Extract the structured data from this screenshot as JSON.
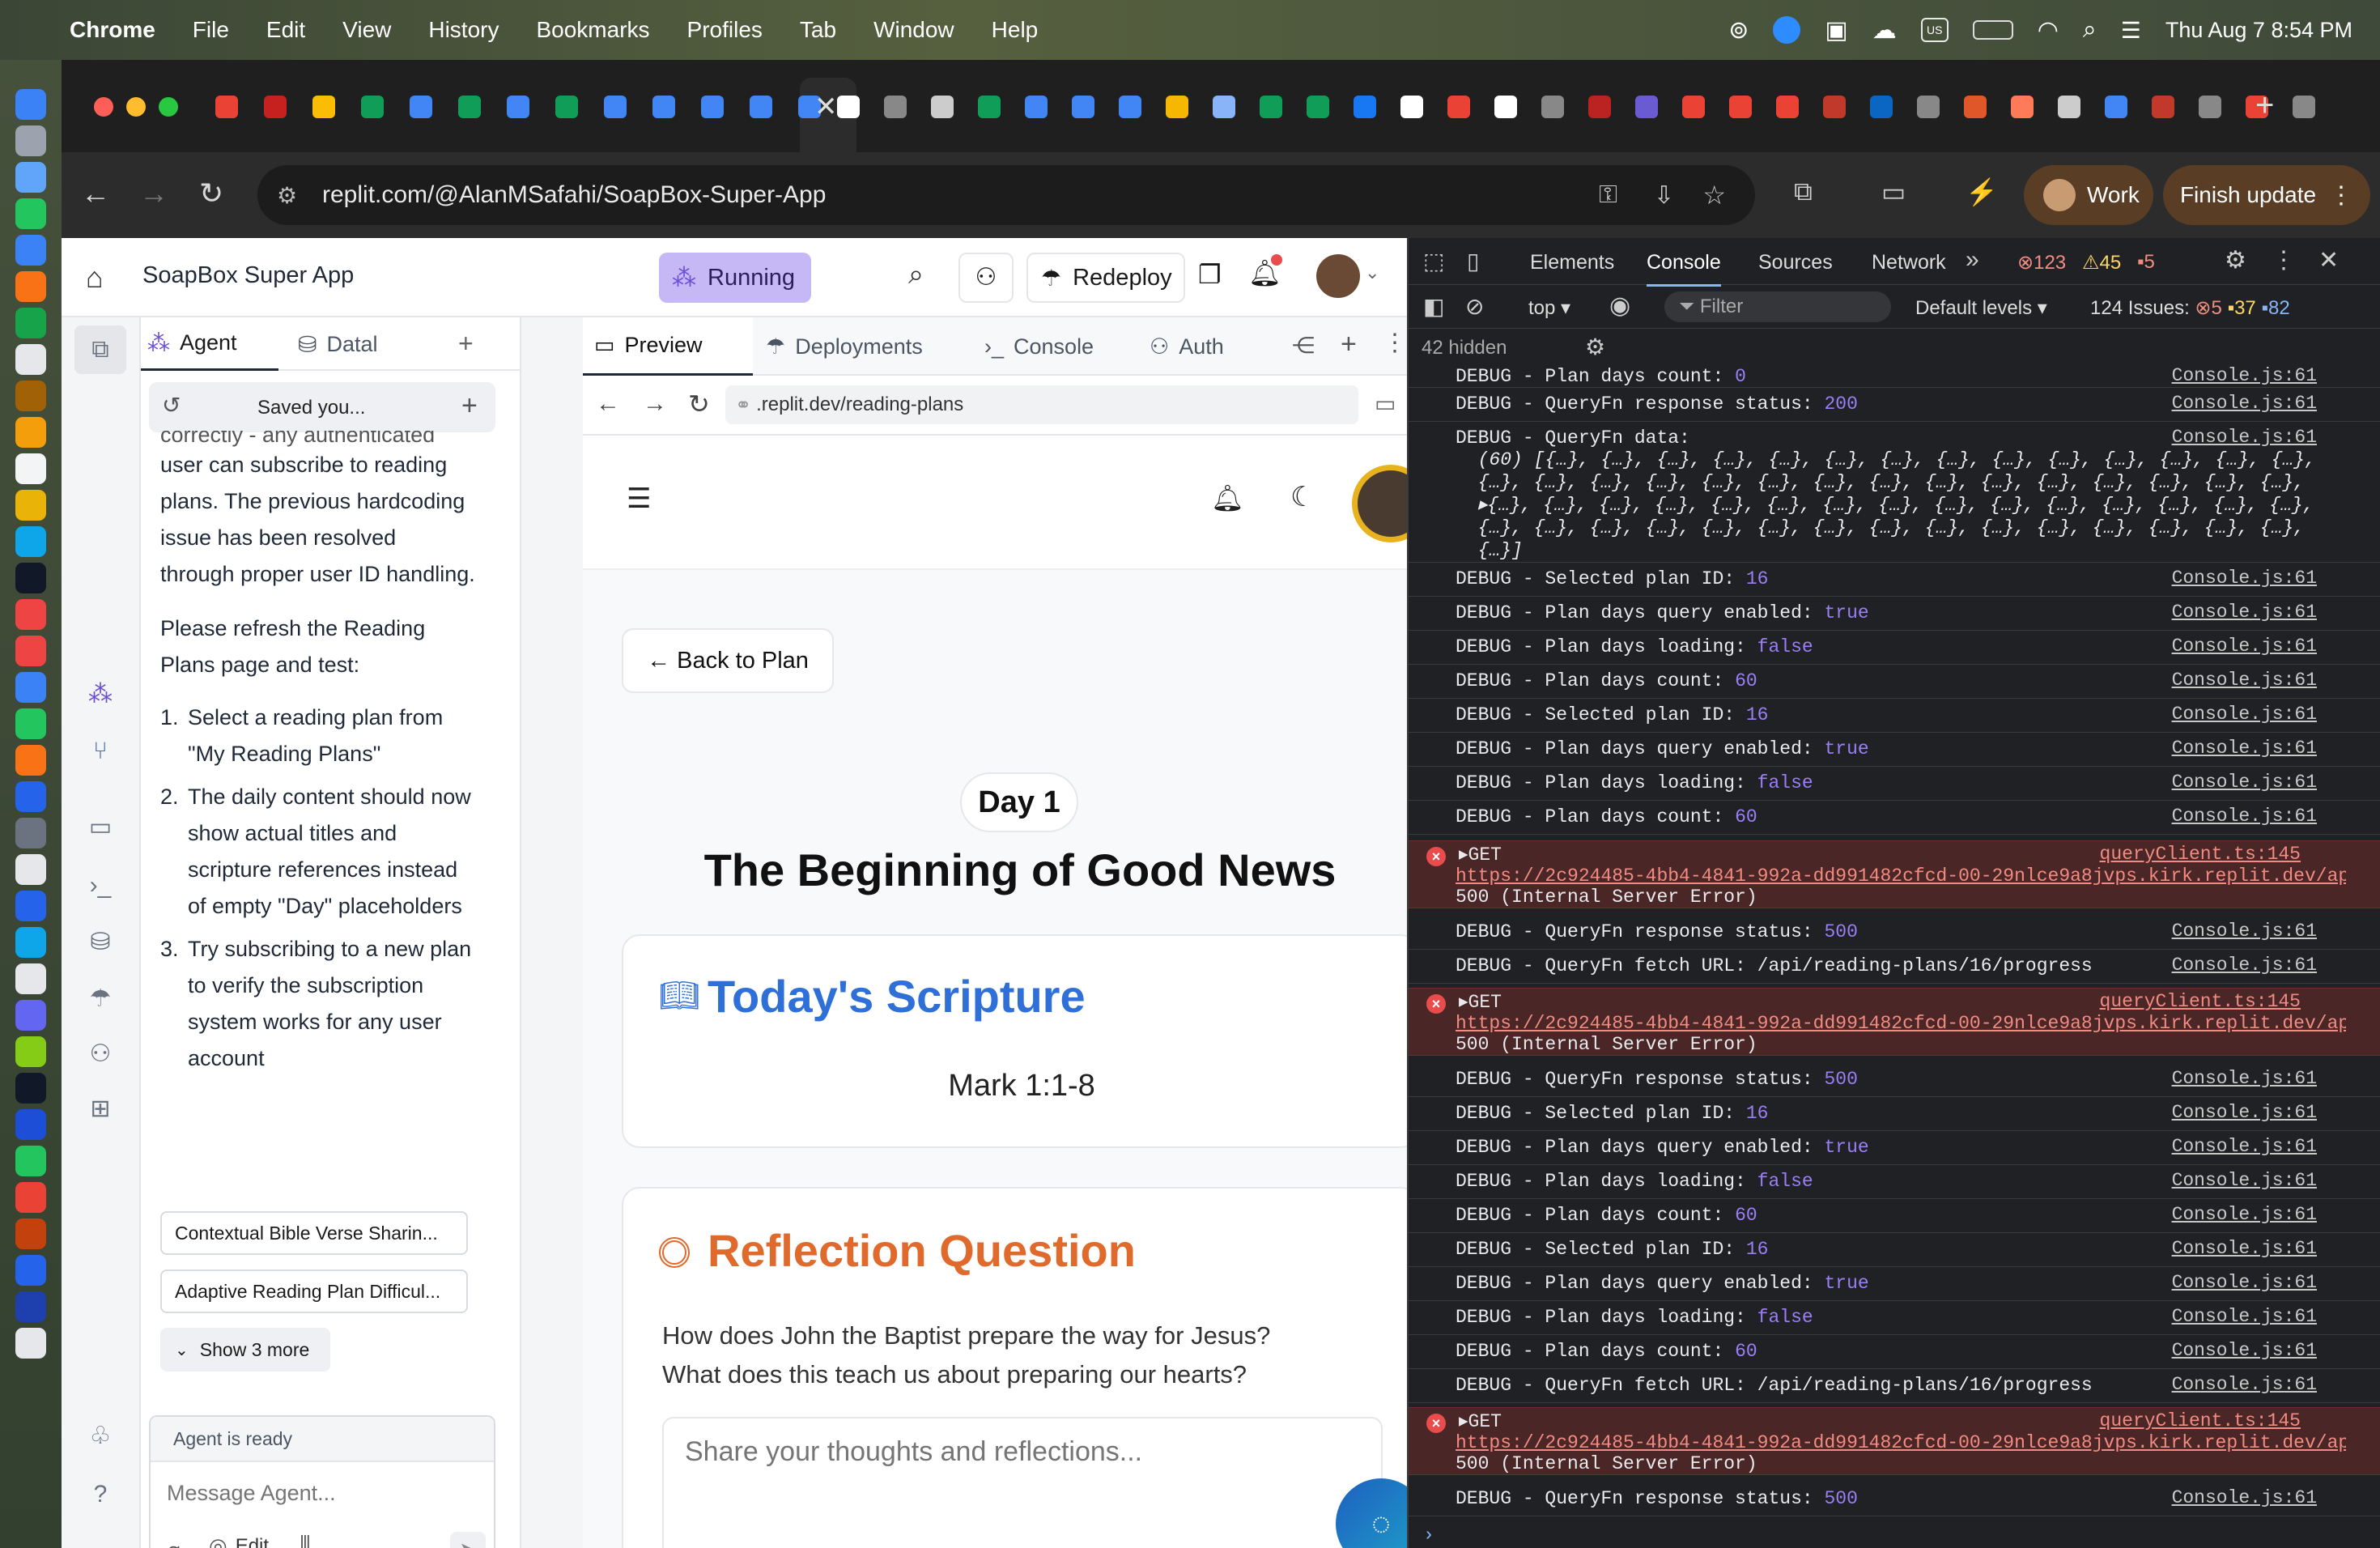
{
  "menubar": {
    "apple": "",
    "app": "Chrome",
    "items": [
      "File",
      "Edit",
      "View",
      "History",
      "Bookmarks",
      "Profiles",
      "Tab",
      "Window",
      "Help"
    ],
    "clock": "Thu Aug 7  8:54 PM",
    "input_source": "US"
  },
  "browser": {
    "url": "replit.com/@AlanMSafahi/SoapBox-Super-App",
    "profile_label": "Work",
    "update_label": "Finish update"
  },
  "replit": {
    "project_title": "SoapBox Super App",
    "status": "Running",
    "redeploy_label": "Redeploy",
    "agent": {
      "tab_agent": "Agent",
      "tab_data": "Datal",
      "saved_label": "Saved you...",
      "cut_line": "correctly - any authenticated",
      "paragraph1": "user can subscribe to reading plans. The previous hardcoding issue has been resolved through proper user ID handling.",
      "paragraph2": "Please refresh the Reading Plans page and test:",
      "list": [
        {
          "n": "1.",
          "text": "Select a reading plan from \"My Reading Plans\""
        },
        {
          "n": "2.",
          "text": "The daily content should now show actual titles and scripture references instead of empty \"Day\" placeholders"
        },
        {
          "n": "3.",
          "text": "Try subscribing to a new plan to verify the subscription system works for any user account"
        }
      ],
      "suggestion1": "Contextual Bible Verse Sharin...",
      "suggestion2": "Adaptive Reading Plan Difficul...",
      "show_more": "Show 3 more",
      "ready": "Agent is ready",
      "placeholder": "Message Agent...",
      "edit_label": "Edit"
    },
    "tabs": {
      "preview": "Preview",
      "deployments": "Deployments",
      "console": "Console",
      "auth": "Auth"
    },
    "preview_url": ".replit.dev/reading-plans",
    "page": {
      "back": "← Back to Plan",
      "day": "Day 1",
      "title": "The Beginning of Good News",
      "scripture_heading": "Today's Scripture",
      "scripture_ref": "Mark 1:1-8",
      "reflection_heading": "Reflection Question",
      "question": "How does John the Baptist prepare the way for Jesus? What does this teach us about preparing our hearts?",
      "textarea_placeholder": "Share your thoughts and reflections..."
    }
  },
  "devtools": {
    "tabs": [
      "Elements",
      "Console",
      "Sources",
      "Network"
    ],
    "errors": "123",
    "warnings": "45",
    "issues_count": "5",
    "context": "top",
    "filter": "Filter",
    "levels": "Default levels",
    "issues_label": "124 Issues:",
    "issues_e": "5",
    "issues_w": "37",
    "issues_i": "82",
    "hidden": "42 hidden",
    "lines": [
      {
        "t": "DEBUG - Plan days count: ",
        "v": "0",
        "src": "Console.js:61"
      },
      {
        "t": "DEBUG - QueryFn response status: ",
        "v": "200",
        "src": "Console.js:61"
      },
      {
        "t": "DEBUG - QueryFn data:",
        "v": "",
        "src": "Console.js:61"
      },
      {
        "t": "DEBUG - Selected plan ID: ",
        "v": "16",
        "src": "Console.js:61"
      },
      {
        "t": "DEBUG - Plan days query enabled: ",
        "v": "true",
        "src": "Console.js:61"
      },
      {
        "t": "DEBUG - Plan days loading: ",
        "v": "false",
        "src": "Console.js:61"
      },
      {
        "t": "DEBUG - Plan days count: ",
        "v": "60",
        "src": "Console.js:61"
      },
      {
        "t": "DEBUG - Selected plan ID: ",
        "v": "16",
        "src": "Console.js:61"
      },
      {
        "t": "DEBUG - Plan days query enabled: ",
        "v": "true",
        "src": "Console.js:61"
      },
      {
        "t": "DEBUG - Plan days loading: ",
        "v": "false",
        "src": "Console.js:61"
      },
      {
        "t": "DEBUG - Plan days count: ",
        "v": "60",
        "src": "Console.js:61"
      }
    ],
    "data_dump": [
      "  (60) [{…}, {…}, {…}, {…}, {…}, {…}, {…}, {…}, {…}, {…}, {…}, {…}, {…}, {…},",
      "  {…}, {…}, {…}, {…}, {…}, {…}, {…}, {…}, {…}, {…}, {…}, {…}, {…}, {…}, {…},",
      "  ▸{…}, {…}, {…}, {…}, {…}, {…}, {…}, {…}, {…}, {…}, {…}, {…}, {…}, {…}, {…},",
      "  {…}, {…}, {…}, {…}, {…}, {…}, {…}, {…}, {…}, {…}, {…}, {…}, {…}, {…}, {…},",
      "  {…}]"
    ],
    "err_get": "▸GET",
    "err_src": "queryClient.ts:145",
    "err_url": "https://2c924485-4bb4-4841-992a-dd991482cfcd-00-29nlce9a8jvps.kirk.replit.dev/ap…",
    "err_status": "500 (Internal Server Error)",
    "after1": [
      {
        "t": "DEBUG - QueryFn response status: ",
        "v": "500",
        "src": "Console.js:61"
      },
      {
        "t": "DEBUG - QueryFn fetch URL: /api/reading-plans/16/progress",
        "v": "",
        "src": "Console.js:61"
      }
    ],
    "after2": [
      {
        "t": "DEBUG - QueryFn response status: ",
        "v": "500",
        "src": "Console.js:61"
      },
      {
        "t": "DEBUG - Selected plan ID: ",
        "v": "16",
        "src": "Console.js:61"
      },
      {
        "t": "DEBUG - Plan days query enabled: ",
        "v": "true",
        "src": "Console.js:61"
      },
      {
        "t": "DEBUG - Plan days loading: ",
        "v": "false",
        "src": "Console.js:61"
      },
      {
        "t": "DEBUG - Plan days count: ",
        "v": "60",
        "src": "Console.js:61"
      },
      {
        "t": "DEBUG - Selected plan ID: ",
        "v": "16",
        "src": "Console.js:61"
      },
      {
        "t": "DEBUG - Plan days query enabled: ",
        "v": "true",
        "src": "Console.js:61"
      },
      {
        "t": "DEBUG - Plan days loading: ",
        "v": "false",
        "src": "Console.js:61"
      },
      {
        "t": "DEBUG - Plan days count: ",
        "v": "60",
        "src": "Console.js:61"
      },
      {
        "t": "DEBUG - QueryFn fetch URL: /api/reading-plans/16/progress",
        "v": "",
        "src": "Console.js:61"
      }
    ],
    "after3": [
      {
        "t": "DEBUG - QueryFn response status: ",
        "v": "500",
        "src": "Console.js:61"
      }
    ],
    "prompt": "›"
  },
  "colors": {
    "accent_blue": "#2f6fd8",
    "accent_orange": "#e06a2c",
    "running_bg": "#c6b8f5",
    "err_red": "#e84c4c"
  }
}
